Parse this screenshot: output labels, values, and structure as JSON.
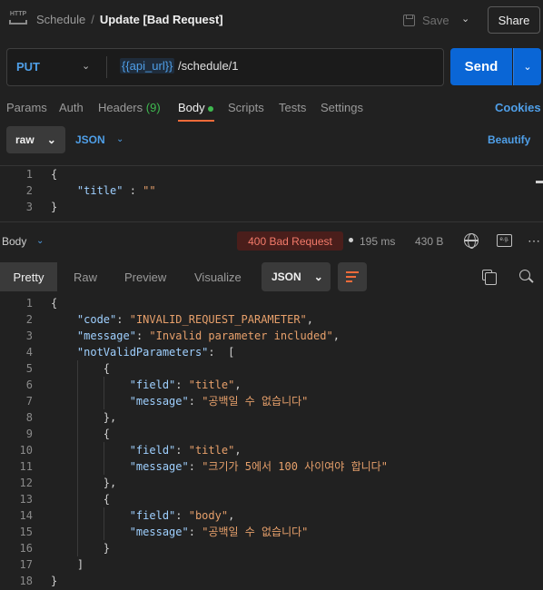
{
  "header": {
    "icon_text": "HTTP",
    "collection": "Schedule",
    "separator": "/",
    "title": "Update [Bad Request]",
    "save_label": "Save",
    "share_label": "Share"
  },
  "request": {
    "method": "PUT",
    "url_variable": "{{api_url}}",
    "url_path": " /schedule/1",
    "send_label": "Send"
  },
  "tabs": {
    "params": "Params",
    "auth": "Auth",
    "headers": "Headers",
    "headers_count": "(9)",
    "body": "Body",
    "scripts": "Scripts",
    "tests": "Tests",
    "settings": "Settings",
    "cookies": "Cookies"
  },
  "body_mode": {
    "raw": "raw",
    "language": "JSON",
    "beautify": "Beautify"
  },
  "request_body": [
    {
      "n": "1",
      "text": "{"
    },
    {
      "n": "2",
      "key": "\"title\"",
      "sep": " : ",
      "value": "\"\""
    },
    {
      "n": "3",
      "text": "}"
    }
  ],
  "response": {
    "body_label": "Body",
    "status": "400 Bad Request",
    "time": "195 ms",
    "size": "430 B",
    "example_icon_text": "e.g.",
    "view_tabs": {
      "pretty": "Pretty",
      "raw": "Raw",
      "preview": "Preview",
      "visualize": "Visualize"
    },
    "format": "JSON",
    "lines": [
      {
        "n": "1",
        "indent": 0,
        "punc": "{"
      },
      {
        "n": "2",
        "indent": 1,
        "key": "\"code\"",
        "value": "\"INVALID_REQUEST_PARAMETER\"",
        "tail": ","
      },
      {
        "n": "3",
        "indent": 1,
        "key": "\"message\"",
        "value": "\"Invalid parameter included\"",
        "tail": ","
      },
      {
        "n": "4",
        "indent": 1,
        "key": "\"notValidParameters\"",
        "punc_after": " ["
      },
      {
        "n": "5",
        "indent": 2,
        "punc": "{"
      },
      {
        "n": "6",
        "indent": 3,
        "key": "\"field\"",
        "value": "\"title\"",
        "tail": ","
      },
      {
        "n": "7",
        "indent": 3,
        "key": "\"message\"",
        "value": "\"공백일 수 없습니다\""
      },
      {
        "n": "8",
        "indent": 2,
        "punc": "},"
      },
      {
        "n": "9",
        "indent": 2,
        "punc": "{"
      },
      {
        "n": "10",
        "indent": 3,
        "key": "\"field\"",
        "value": "\"title\"",
        "tail": ","
      },
      {
        "n": "11",
        "indent": 3,
        "key": "\"message\"",
        "value": "\"크기가 5에서 100 사이여야 합니다\""
      },
      {
        "n": "12",
        "indent": 2,
        "punc": "},"
      },
      {
        "n": "13",
        "indent": 2,
        "punc": "{"
      },
      {
        "n": "14",
        "indent": 3,
        "key": "\"field\"",
        "value": "\"body\"",
        "tail": ","
      },
      {
        "n": "15",
        "indent": 3,
        "key": "\"message\"",
        "value": "\"공백일 수 없습니다\""
      },
      {
        "n": "16",
        "indent": 2,
        "punc": "}"
      },
      {
        "n": "17",
        "indent": 1,
        "punc": "]"
      },
      {
        "n": "18",
        "indent": 0,
        "punc": "}"
      }
    ]
  },
  "colors": {
    "accent_blue": "#4f9fe8",
    "send_blue": "#0a66d6",
    "status_red": "#f37a6a",
    "active_orange": "#f26b3a",
    "green": "#3fb950"
  }
}
